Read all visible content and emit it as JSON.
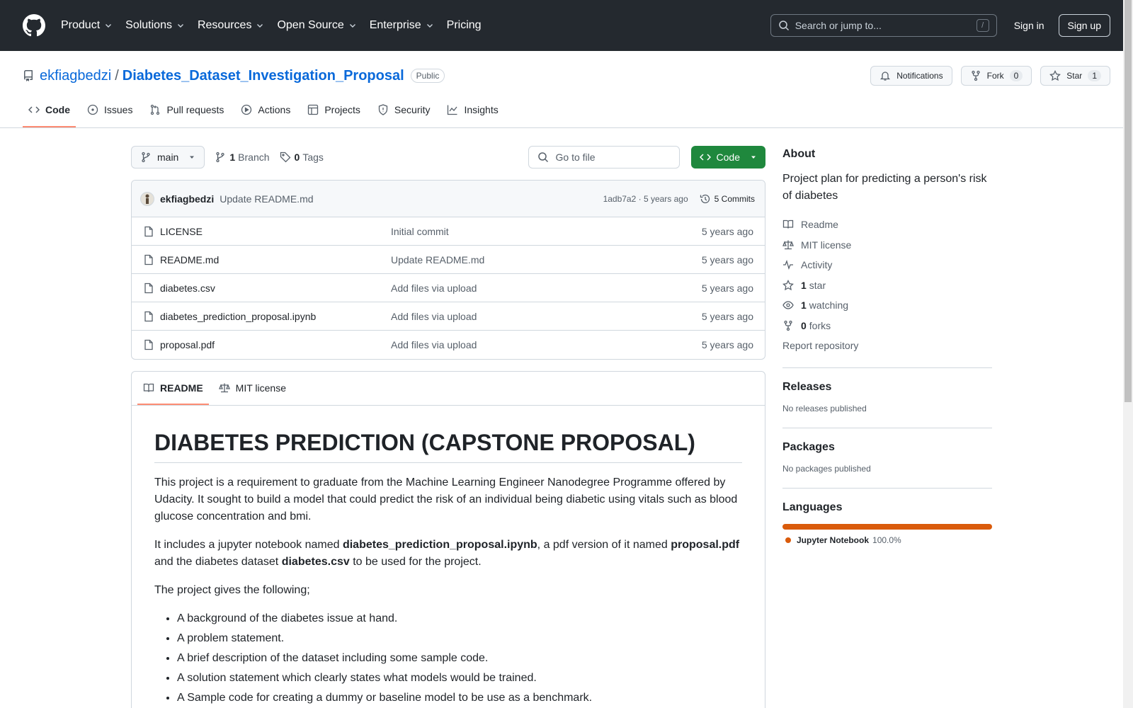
{
  "header": {
    "nav": [
      {
        "label": "Product",
        "caret": true
      },
      {
        "label": "Solutions",
        "caret": true
      },
      {
        "label": "Resources",
        "caret": true
      },
      {
        "label": "Open Source",
        "caret": true
      },
      {
        "label": "Enterprise",
        "caret": true
      },
      {
        "label": "Pricing",
        "caret": false
      }
    ],
    "search_placeholder": "Search or jump to...",
    "search_key": "/",
    "signin": "Sign in",
    "signup": "Sign up"
  },
  "repo": {
    "owner": "ekfiagbedzi",
    "separator": "/",
    "name": "Diabetes_Dataset_Investigation_Proposal",
    "visibility": "Public",
    "notifications_label": "Notifications",
    "fork_label": "Fork",
    "fork_count": "0",
    "star_label": "Star",
    "star_count": "1",
    "tabs": [
      "Code",
      "Issues",
      "Pull requests",
      "Actions",
      "Projects",
      "Security",
      "Insights"
    ]
  },
  "filenav": {
    "branch": "main",
    "branch_count": "1",
    "branch_label": "Branch",
    "tag_count": "0",
    "tag_label": "Tags",
    "goto_placeholder": "Go to file",
    "code_label": "Code"
  },
  "commit": {
    "author": "ekfiagbedzi",
    "message": "Update README.md",
    "meta": "1adb7a2 · 5 years ago",
    "commits_label": "5 Commits"
  },
  "files": [
    {
      "name": "LICENSE",
      "message": "Initial commit",
      "age": "5 years ago"
    },
    {
      "name": "README.md",
      "message": "Update README.md",
      "age": "5 years ago"
    },
    {
      "name": "diabetes.csv",
      "message": "Add files via upload",
      "age": "5 years ago"
    },
    {
      "name": "diabetes_prediction_proposal.ipynb",
      "message": "Add files via upload",
      "age": "5 years ago"
    },
    {
      "name": "proposal.pdf",
      "message": "Add files via upload",
      "age": "5 years ago"
    }
  ],
  "readme": {
    "tabs": [
      "README",
      "MIT license"
    ],
    "title": "DIABETES PREDICTION (CAPSTONE PROPOSAL)",
    "p1": "This project is a requirement to graduate from the Machine Learning Engineer Nanodegree Programme offered by Udacity. It sought to build a model that could predict the risk of an individual being diabetic using vitals such as blood glucose concentration and bmi.",
    "p2_a": "It includes a jupyter notebook named ",
    "p2_b": "diabetes_prediction_proposal.ipynb",
    "p2_c": ", a pdf version of it named ",
    "p2_d": "proposal.pdf",
    "p2_e": " and the diabetes dataset ",
    "p2_f": "diabetes.csv",
    "p2_g": " to be used for the project.",
    "p3": "The project gives the following;",
    "list": [
      "A background of the diabetes issue at hand.",
      "A problem statement.",
      "A brief description of the dataset including some sample code.",
      "A solution statement which clearly states what models would be trained.",
      "A Sample code for creating a dummy or baseline model to be use as a benchmark."
    ]
  },
  "about": {
    "heading": "About",
    "description": "Project plan for predicting a person's risk of diabetes",
    "readme": "Readme",
    "license": "MIT license",
    "activity": "Activity",
    "stars_count": "1",
    "stars_label": "star",
    "watching_count": "1",
    "watching_label": "watching",
    "forks_count": "0",
    "forks_label": "forks",
    "report": "Report repository"
  },
  "releases": {
    "heading": "Releases",
    "empty": "No releases published"
  },
  "packages": {
    "heading": "Packages",
    "empty": "No packages published"
  },
  "languages": {
    "heading": "Languages",
    "items": [
      {
        "name": "Jupyter Notebook",
        "percent": "100.0%",
        "fraction": 1.0,
        "color": "#DA5B0B"
      }
    ]
  },
  "colors": {
    "accent": "#0969da",
    "primary_button": "#1f883d",
    "tab_underline": "#fd8c73",
    "header_bg": "#24292f"
  }
}
